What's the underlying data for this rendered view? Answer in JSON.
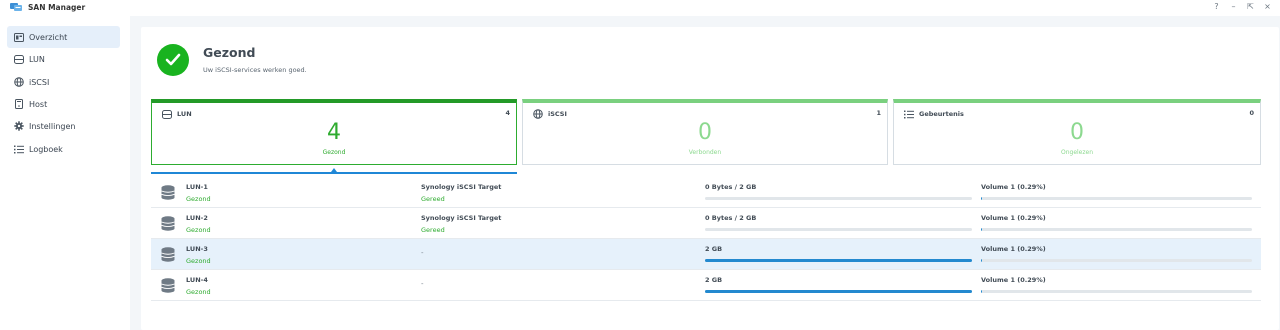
{
  "window": {
    "title": "SAN Manager",
    "controls": [
      "?",
      "–",
      "⇱",
      "×"
    ]
  },
  "sidebar": {
    "items": [
      {
        "label": "Overzicht",
        "icon": "overview-icon",
        "active": true
      },
      {
        "label": "LUN",
        "icon": "lun-icon",
        "active": false
      },
      {
        "label": "iSCSI",
        "icon": "iscsi-icon",
        "active": false
      },
      {
        "label": "Host",
        "icon": "host-icon",
        "active": false
      },
      {
        "label": "Instellingen",
        "icon": "gear-icon",
        "active": false
      },
      {
        "label": "Logboek",
        "icon": "log-icon",
        "active": false
      }
    ]
  },
  "health": {
    "title": "Gezond",
    "subtitle": "Uw iSCSI-services werken goed.",
    "color": "#19b31f"
  },
  "cards": [
    {
      "title": "LUN",
      "icon": "lun-icon",
      "count": "4",
      "value": "4",
      "status": "Gezond",
      "active": true
    },
    {
      "title": "iSCSI",
      "icon": "iscsi-icon",
      "count": "1",
      "value": "0",
      "status": "Verbonden",
      "active": false
    },
    {
      "title": "Gebeurtenis",
      "icon": "list-icon",
      "count": "0",
      "value": "0",
      "status": "Ongelezen",
      "active": false
    }
  ],
  "luns": [
    {
      "name": "LUN-1",
      "status": "Gezond",
      "target": "Synology iSCSI Target",
      "target_status": "Gereed",
      "size": "0 Bytes / 2 GB",
      "size_fill": 0,
      "volume": "Volume 1 (0.29%)",
      "volume_fill": 0.0029,
      "selected": false
    },
    {
      "name": "LUN-2",
      "status": "Gezond",
      "target": "Synology iSCSI Target",
      "target_status": "Gereed",
      "size": "0 Bytes / 2 GB",
      "size_fill": 0,
      "volume": "Volume 1 (0.29%)",
      "volume_fill": 0.0029,
      "selected": false
    },
    {
      "name": "LUN-3",
      "status": "Gezond",
      "target": "-",
      "target_status": "",
      "size": "2 GB",
      "size_fill": 1,
      "volume": "Volume 1 (0.29%)",
      "volume_fill": 0.0029,
      "selected": true
    },
    {
      "name": "LUN-4",
      "status": "Gezond",
      "target": "-",
      "target_status": "",
      "size": "2 GB",
      "size_fill": 1,
      "volume": "Volume 1 (0.29%)",
      "volume_fill": 0.0029,
      "selected": false
    }
  ],
  "colors": {
    "accent": "#1f87d6",
    "healthy": "#2eab2f",
    "bar_fill": "#2389cf"
  }
}
